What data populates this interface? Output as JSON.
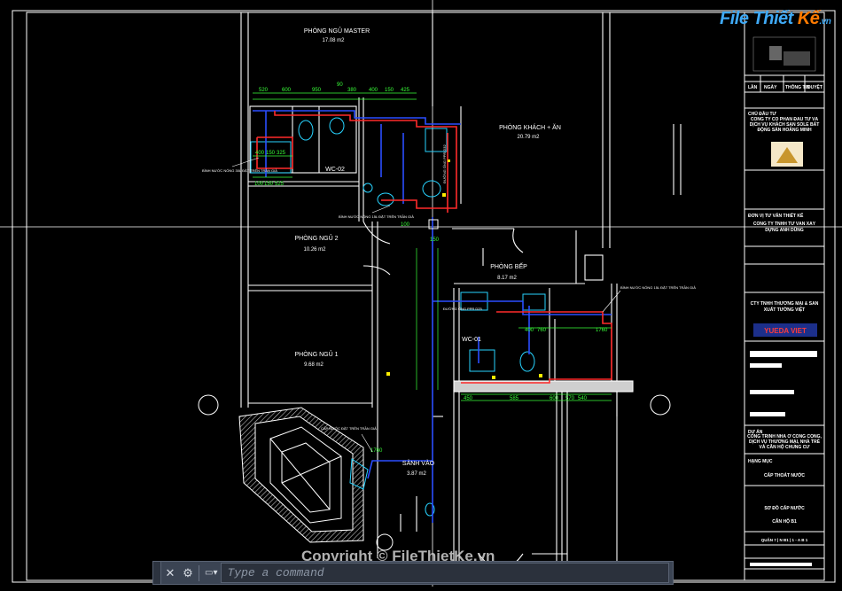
{
  "rooms": [
    {
      "name": "PHÒNG NGỦ MASTER",
      "area": "17.08 m2"
    },
    {
      "name": "PHÒNG KHÁCH + ĂN",
      "area": "20.79 m2"
    },
    {
      "name": "PHÒNG NGỦ 2",
      "area": "10.26 m2"
    },
    {
      "name": "PHÒNG BẾP",
      "area": "8.17 m2"
    },
    {
      "name": "PHÒNG NGỦ 1",
      "area": "9.68 m2"
    },
    {
      "name": "SẢNH VÀO",
      "area": "3.87 m2"
    }
  ],
  "wc_labels": [
    "WC-02",
    "WC-01"
  ],
  "dimensions_top": [
    "520",
    "600",
    "950",
    "90",
    "380",
    "400",
    "150",
    "425"
  ],
  "dimensions_bottom": [
    "450",
    "585",
    "600",
    "570",
    "540"
  ],
  "dimensions_kitchen": [
    "400",
    "760",
    "1760"
  ],
  "dimensions_misc": [
    "400",
    "150",
    "325",
    "100",
    "150",
    "525",
    "100",
    "150",
    "1760"
  ],
  "pipe_labels": {
    "main_left": "ĐƯỜNG ỐNG PPR D25",
    "riser": "ĐƯỜNG ỐNG PPR D32",
    "callout_1": "BÌNH NƯỚC NÓNG 30L ĐẶT TRÊN TRẦN GIẢ",
    "callout_2": "BÌNH NƯỚC NÓNG 15L ĐẶT TRÊN TRẦN GIẢ",
    "callout_3": "CẤP NƯỚC ĐẶT TRÊN TRẦN GIẢ",
    "callout_4": "BÌNH NƯỚC NÓNG 15L ĐẶT TRÊN TRẦN GIẢ"
  },
  "title_block": {
    "rev_headers": [
      "LẦN",
      "NGÀY",
      "THÔNG TIN",
      "DUYỆT"
    ],
    "owner_label": "CHỦ ĐẦU TƯ",
    "owner_name": "CÔNG TY CỔ PHẦN ĐẦU TƯ VÀ DỊCH VỤ KHÁCH SẠN SOLE BẤT ĐỘNG SẢN HOÀNG MINH",
    "consultant_label": "ĐƠN VỊ TƯ VẤN THIẾT KẾ",
    "consultant_name": "CÔNG TY TNHH TƯ VẤN XÂY DỰNG ANH DŨNG",
    "partner_name": "CTY TNHH THƯƠNG MẠI & SẢN XUẤT TƯỜNG VIỆT",
    "partner_logo": "YUEDA VIET",
    "project_label": "DỰ ÁN",
    "project_name": "CÔNG TRÌNH NHÀ Ở CÔNG CỘNG, DỊCH VỤ THƯƠNG MẠI, NHÀ TRẺ VÀ CĂN HỘ CHUNG CƯ",
    "category_label": "HẠNG MỤC",
    "category_name": "CẤP THOÁT NƯỚC",
    "drawing_title": "SƠ ĐỒ CẤP NƯỚC",
    "unit": "CĂN HỘ B1",
    "sheet_no": "QUẬN 7 | N B1 | 1 - A B 1"
  },
  "watermark": "Copyright © FileThietKe.vn",
  "logo": {
    "part1": "File Thiết",
    "part2": "Kế",
    "suffix": ".vn"
  },
  "command_line": {
    "placeholder": "Type a command",
    "close_glyph": "✕",
    "settings_glyph": "⚙",
    "prompt_glyph": "▭▾"
  },
  "colors": {
    "wall": "#ffffff",
    "pipe_hot": "#ff2a2a",
    "pipe_cold": "#2a4dff",
    "dimension": "#38ff38",
    "fixture": "#27d3ff",
    "annot": "#ffffff",
    "hatch": "#c8c8c8",
    "yellow": "#ffee00"
  }
}
